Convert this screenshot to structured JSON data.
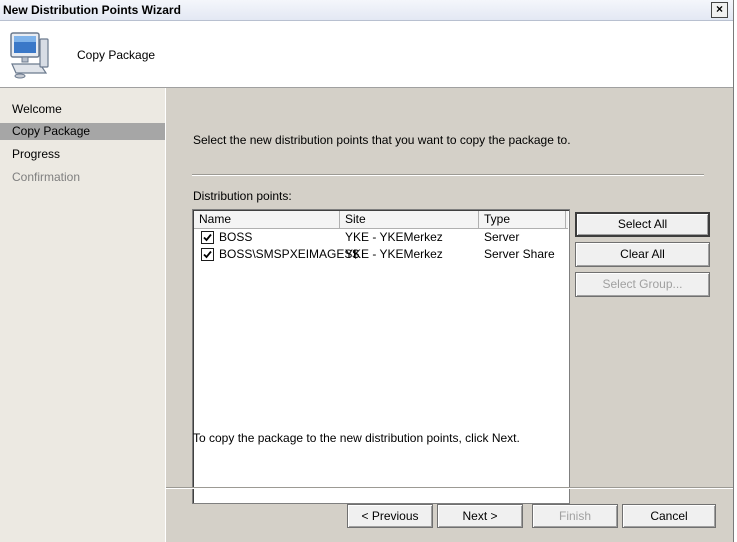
{
  "window": {
    "title": "New Distribution Points Wizard",
    "close_glyph": "×"
  },
  "header": {
    "title": "Copy Package",
    "icon": "computer-icon"
  },
  "nav": {
    "items": [
      {
        "label": "Welcome"
      },
      {
        "label": "Copy Package"
      },
      {
        "label": "Progress"
      },
      {
        "label": "Confirmation"
      }
    ]
  },
  "main": {
    "instruction": "Select the new distribution points that you want to copy the package to.",
    "list_label": "Distribution points:",
    "columns": [
      "Name",
      "Site",
      "Type"
    ],
    "rows": [
      {
        "checked": true,
        "name": "BOSS",
        "site": "YKE - YKEMerkez",
        "type": "Server"
      },
      {
        "checked": true,
        "name": "BOSS\\SMSPXEIMAGES$",
        "site": "YKE - YKEMerkez",
        "type": "Server Share"
      }
    ],
    "select_all_label": "Select All",
    "clear_all_label": "Clear All",
    "select_group_label": "Select Group...",
    "note": "To copy the package to the new distribution points, click Next."
  },
  "footer": {
    "previous_label": "< Previous",
    "next_label": "Next >",
    "finish_label": "Finish",
    "cancel_label": "Cancel"
  }
}
